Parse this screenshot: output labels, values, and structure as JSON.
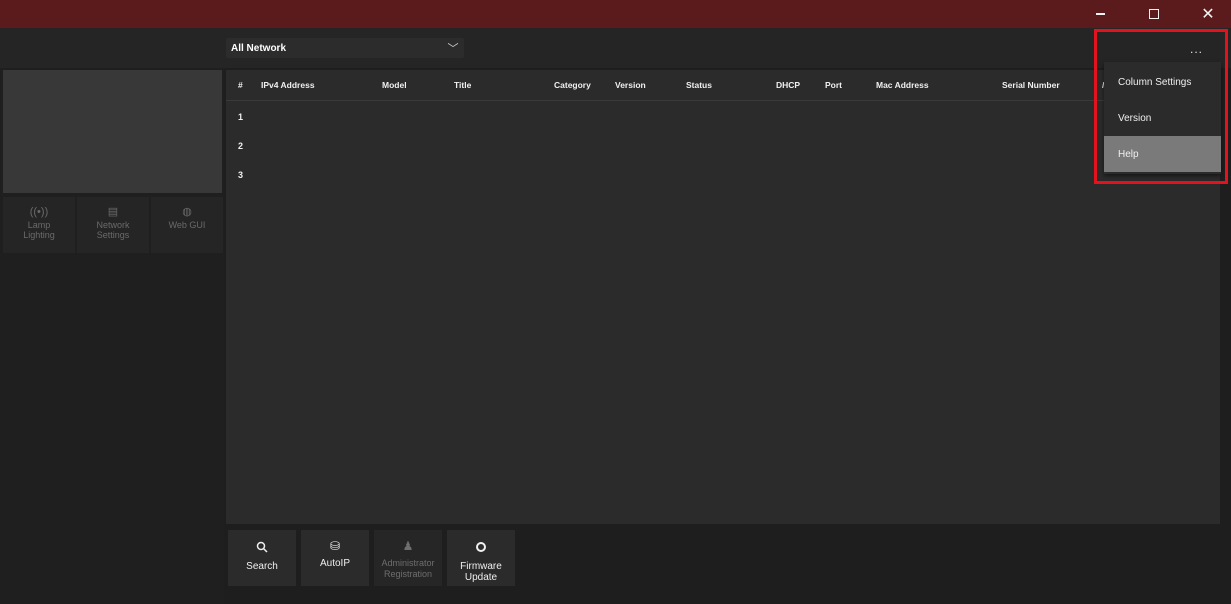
{
  "window": {
    "minimize_glyph": "–",
    "close_glyph": "✕"
  },
  "toolbar": {
    "network_select_value": "All Network",
    "network_select_chevron": "﹀",
    "more_label": "..."
  },
  "left_panel": {
    "tools": [
      {
        "label": "Lamp Lighting",
        "icon": "((•))",
        "icon_name": "lamp-icon"
      },
      {
        "label": "Network Settings",
        "icon": "▤",
        "icon_name": "network-settings-icon"
      },
      {
        "label": "Web GUI",
        "icon": "◍",
        "icon_name": "web-gui-icon"
      }
    ]
  },
  "table": {
    "columns": [
      "#",
      "IPv4 Address",
      "Model",
      "Title",
      "Category",
      "Version",
      "Status",
      "DHCP",
      "Port",
      "Mac Address",
      "Serial Number"
    ],
    "rows": [
      "1",
      "2",
      "3"
    ],
    "truncated_header_char": "/"
  },
  "bottom_buttons": [
    {
      "label": "Search",
      "icon": "🔍︎",
      "icon_name": "search-icon",
      "enabled": true
    },
    {
      "label": "AutoIP",
      "icon": "⛁",
      "icon_name": "autoip-icon",
      "enabled": true
    },
    {
      "label": "Administrator Registration",
      "icon": "♟",
      "icon_name": "admin-icon",
      "enabled": false
    },
    {
      "label": "Firmware Update",
      "icon": "⭘",
      "icon_name": "firmware-icon",
      "enabled": true
    }
  ],
  "menu": {
    "items": [
      {
        "label": "Column Settings"
      },
      {
        "label": "Version"
      },
      {
        "label": "Help",
        "highlighted": true
      }
    ]
  },
  "colors": {
    "titlebar": "#5b1a1c",
    "annotation": "#e4121d",
    "highlight": "#7a7a7a"
  }
}
